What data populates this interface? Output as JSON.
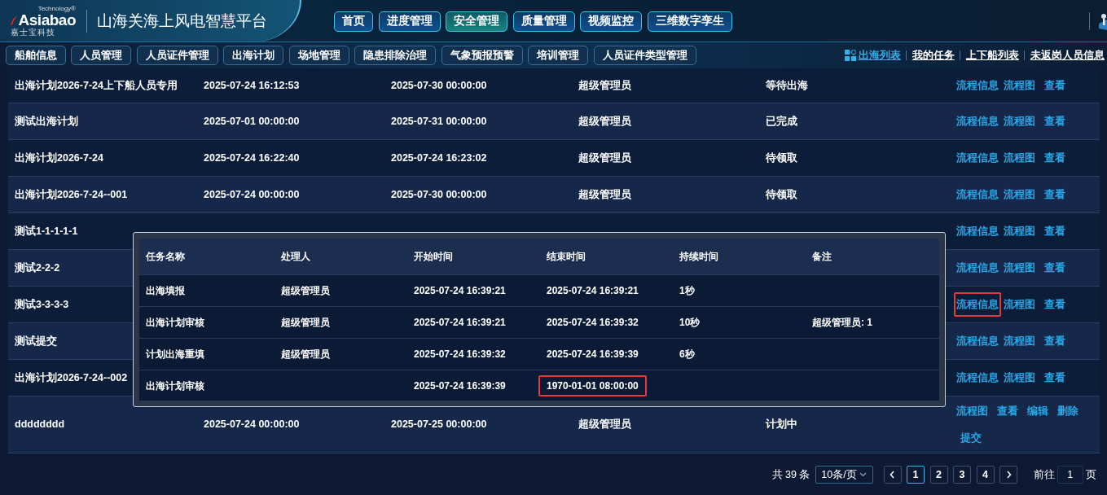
{
  "header": {
    "logo": {
      "brand": "Asiabao",
      "tagline": "Technology®",
      "subtitle": "嘉士宝科技"
    },
    "title": "山海关海上风电智慧平台",
    "top_nav": [
      {
        "label": "首页",
        "selected": false
      },
      {
        "label": "进度管理",
        "selected": false
      },
      {
        "label": "安全管理",
        "selected": true
      },
      {
        "label": "质量管理",
        "selected": false
      },
      {
        "label": "视频监控",
        "selected": false
      },
      {
        "label": "三维数字孪生",
        "selected": false
      }
    ]
  },
  "sub_nav": [
    "船舶信息",
    "人员管理",
    "人员证件管理",
    "出海计划",
    "场地管理",
    "隐患排除治理",
    "气象预报预警",
    "培训管理",
    "人员证件类型管理"
  ],
  "view_links": [
    {
      "label": "出海列表",
      "selected": true
    },
    {
      "label": "我的任务",
      "selected": false
    },
    {
      "label": "上下船列表",
      "selected": false
    },
    {
      "label": "未返岗人员信息",
      "selected": false
    }
  ],
  "table": {
    "rows": [
      {
        "name": "出海计划2026-7-24上下船人员专用",
        "start": "2025-07-24 16:12:53",
        "end": "2025-07-30 00:00:00",
        "creator": "超级管理员",
        "status": "等待出海",
        "actions": [
          {
            "label": "流程信息",
            "highlighted": false
          },
          {
            "label": "流程图",
            "highlighted": false
          },
          {
            "label": "查看",
            "highlighted": false
          }
        ]
      },
      {
        "name": "测试出海计划",
        "start": "2025-07-01 00:00:00",
        "end": "2025-07-31 00:00:00",
        "creator": "超级管理员",
        "status": "已完成",
        "actions": [
          {
            "label": "流程信息",
            "highlighted": false
          },
          {
            "label": "流程图",
            "highlighted": false
          },
          {
            "label": "查看",
            "highlighted": false
          }
        ]
      },
      {
        "name": "出海计划2026-7-24",
        "start": "2025-07-24 16:22:40",
        "end": "2025-07-24 16:23:02",
        "creator": "超级管理员",
        "status": "待领取",
        "actions": [
          {
            "label": "流程信息",
            "highlighted": false
          },
          {
            "label": "流程图",
            "highlighted": false
          },
          {
            "label": "查看",
            "highlighted": false
          }
        ]
      },
      {
        "name": "出海计划2026-7-24--001",
        "start": "2025-07-24 00:00:00",
        "end": "2025-07-30 00:00:00",
        "creator": "超级管理员",
        "status": "待领取",
        "actions": [
          {
            "label": "流程信息",
            "highlighted": false
          },
          {
            "label": "流程图",
            "highlighted": false
          },
          {
            "label": "查看",
            "highlighted": false
          }
        ]
      },
      {
        "name": "测试1-1-1-1-1",
        "actions": [
          {
            "label": "流程信息",
            "highlighted": false
          },
          {
            "label": "流程图",
            "highlighted": false
          },
          {
            "label": "查看",
            "highlighted": false
          }
        ]
      },
      {
        "name": "测试2-2-2",
        "actions": [
          {
            "label": "流程信息",
            "highlighted": false
          },
          {
            "label": "流程图",
            "highlighted": false
          },
          {
            "label": "查看",
            "highlighted": false
          }
        ]
      },
      {
        "name": "测试3-3-3-3",
        "actions": [
          {
            "label": "流程信息",
            "highlighted": true
          },
          {
            "label": "流程图",
            "highlighted": false
          },
          {
            "label": "查看",
            "highlighted": false
          }
        ]
      },
      {
        "name": "测试提交",
        "actions": [
          {
            "label": "流程信息",
            "highlighted": false
          },
          {
            "label": "流程图",
            "highlighted": false
          },
          {
            "label": "查看",
            "highlighted": false
          }
        ]
      },
      {
        "name": "出海计划2026-7-24--002",
        "actions": [
          {
            "label": "流程信息",
            "highlighted": false
          },
          {
            "label": "流程图",
            "highlighted": false
          },
          {
            "label": "查看",
            "highlighted": false
          }
        ]
      },
      {
        "name": "dddddddd",
        "start": "2025-07-24 00:00:00",
        "end": "2025-07-25 00:00:00",
        "creator": "超级管理员",
        "status": "计划中",
        "actions": [
          {
            "label": "流程图",
            "highlighted": false
          },
          {
            "label": "查看",
            "highlighted": false
          },
          {
            "label": "编辑",
            "highlighted": false
          },
          {
            "label": "删除",
            "highlighted": false
          },
          {
            "label": "提交",
            "highlighted": false
          }
        ]
      }
    ]
  },
  "process_popover": {
    "columns": [
      "任务名称",
      "处理人",
      "开始时间",
      "结束时间",
      "持续时间",
      "备注"
    ],
    "rows": [
      {
        "task": "出海填报",
        "handler": "超级管理员",
        "start": "2025-07-24 16:39:21",
        "end": "2025-07-24 16:39:21",
        "duration": "1秒",
        "end_highlighted": false
      },
      {
        "task": "出海计划审核",
        "handler": "超级管理员",
        "start": "2025-07-24 16:39:21",
        "end": "2025-07-24 16:39:32",
        "duration": "10秒",
        "note": "超级管理员: 1",
        "end_highlighted": false
      },
      {
        "task": "计划出海重填",
        "handler": "超级管理员",
        "start": "2025-07-24 16:39:32",
        "end": "2025-07-24 16:39:39",
        "duration": "6秒",
        "end_highlighted": false
      },
      {
        "task": "出海计划审核",
        "start": "2025-07-24 16:39:39",
        "end": "1970-01-01 08:00:00",
        "end_highlighted": true
      }
    ]
  },
  "pagination": {
    "total": "共 39 条",
    "page_size": "10条/页",
    "pages": [
      {
        "label": "1",
        "selected": true
      },
      {
        "label": "2",
        "selected": false
      },
      {
        "label": "3",
        "selected": false
      },
      {
        "label": "4",
        "selected": false
      }
    ],
    "goto_label": "前往",
    "goto_value": "1",
    "goto_suffix": "页"
  }
}
